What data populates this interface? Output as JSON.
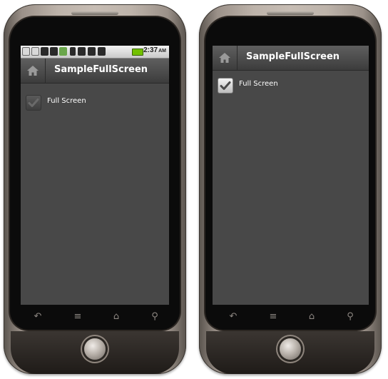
{
  "left_screenshot": {
    "status_bar": {
      "time": "2:37",
      "am_pm": "AM",
      "icons": [
        "lock-icon",
        "gmail-icon",
        "usb-icon",
        "android-icon",
        "market-icon",
        "bluetooth-icon",
        "sd-card-icon",
        "vibrate-icon",
        "signal-icon",
        "battery-icon"
      ]
    },
    "action_bar": {
      "home_icon": "home-icon",
      "title": "SampleFullScreen"
    },
    "checkbox": {
      "label": "Full Screen",
      "checked": false
    },
    "nav": [
      "back-icon",
      "menu-icon",
      "home-icon",
      "search-icon"
    ]
  },
  "right_screenshot": {
    "action_bar": {
      "home_icon": "home-icon",
      "title": "SampleFullScreen"
    },
    "checkbox": {
      "label": "Full Screen",
      "checked": true
    },
    "nav": [
      "back-icon",
      "menu-icon",
      "home-icon",
      "search-icon"
    ]
  },
  "colors": {
    "screen_bg": "#484848",
    "actionbar_bg": "#4a4a4a",
    "battery": "#72c000",
    "text": "#ffffff"
  }
}
